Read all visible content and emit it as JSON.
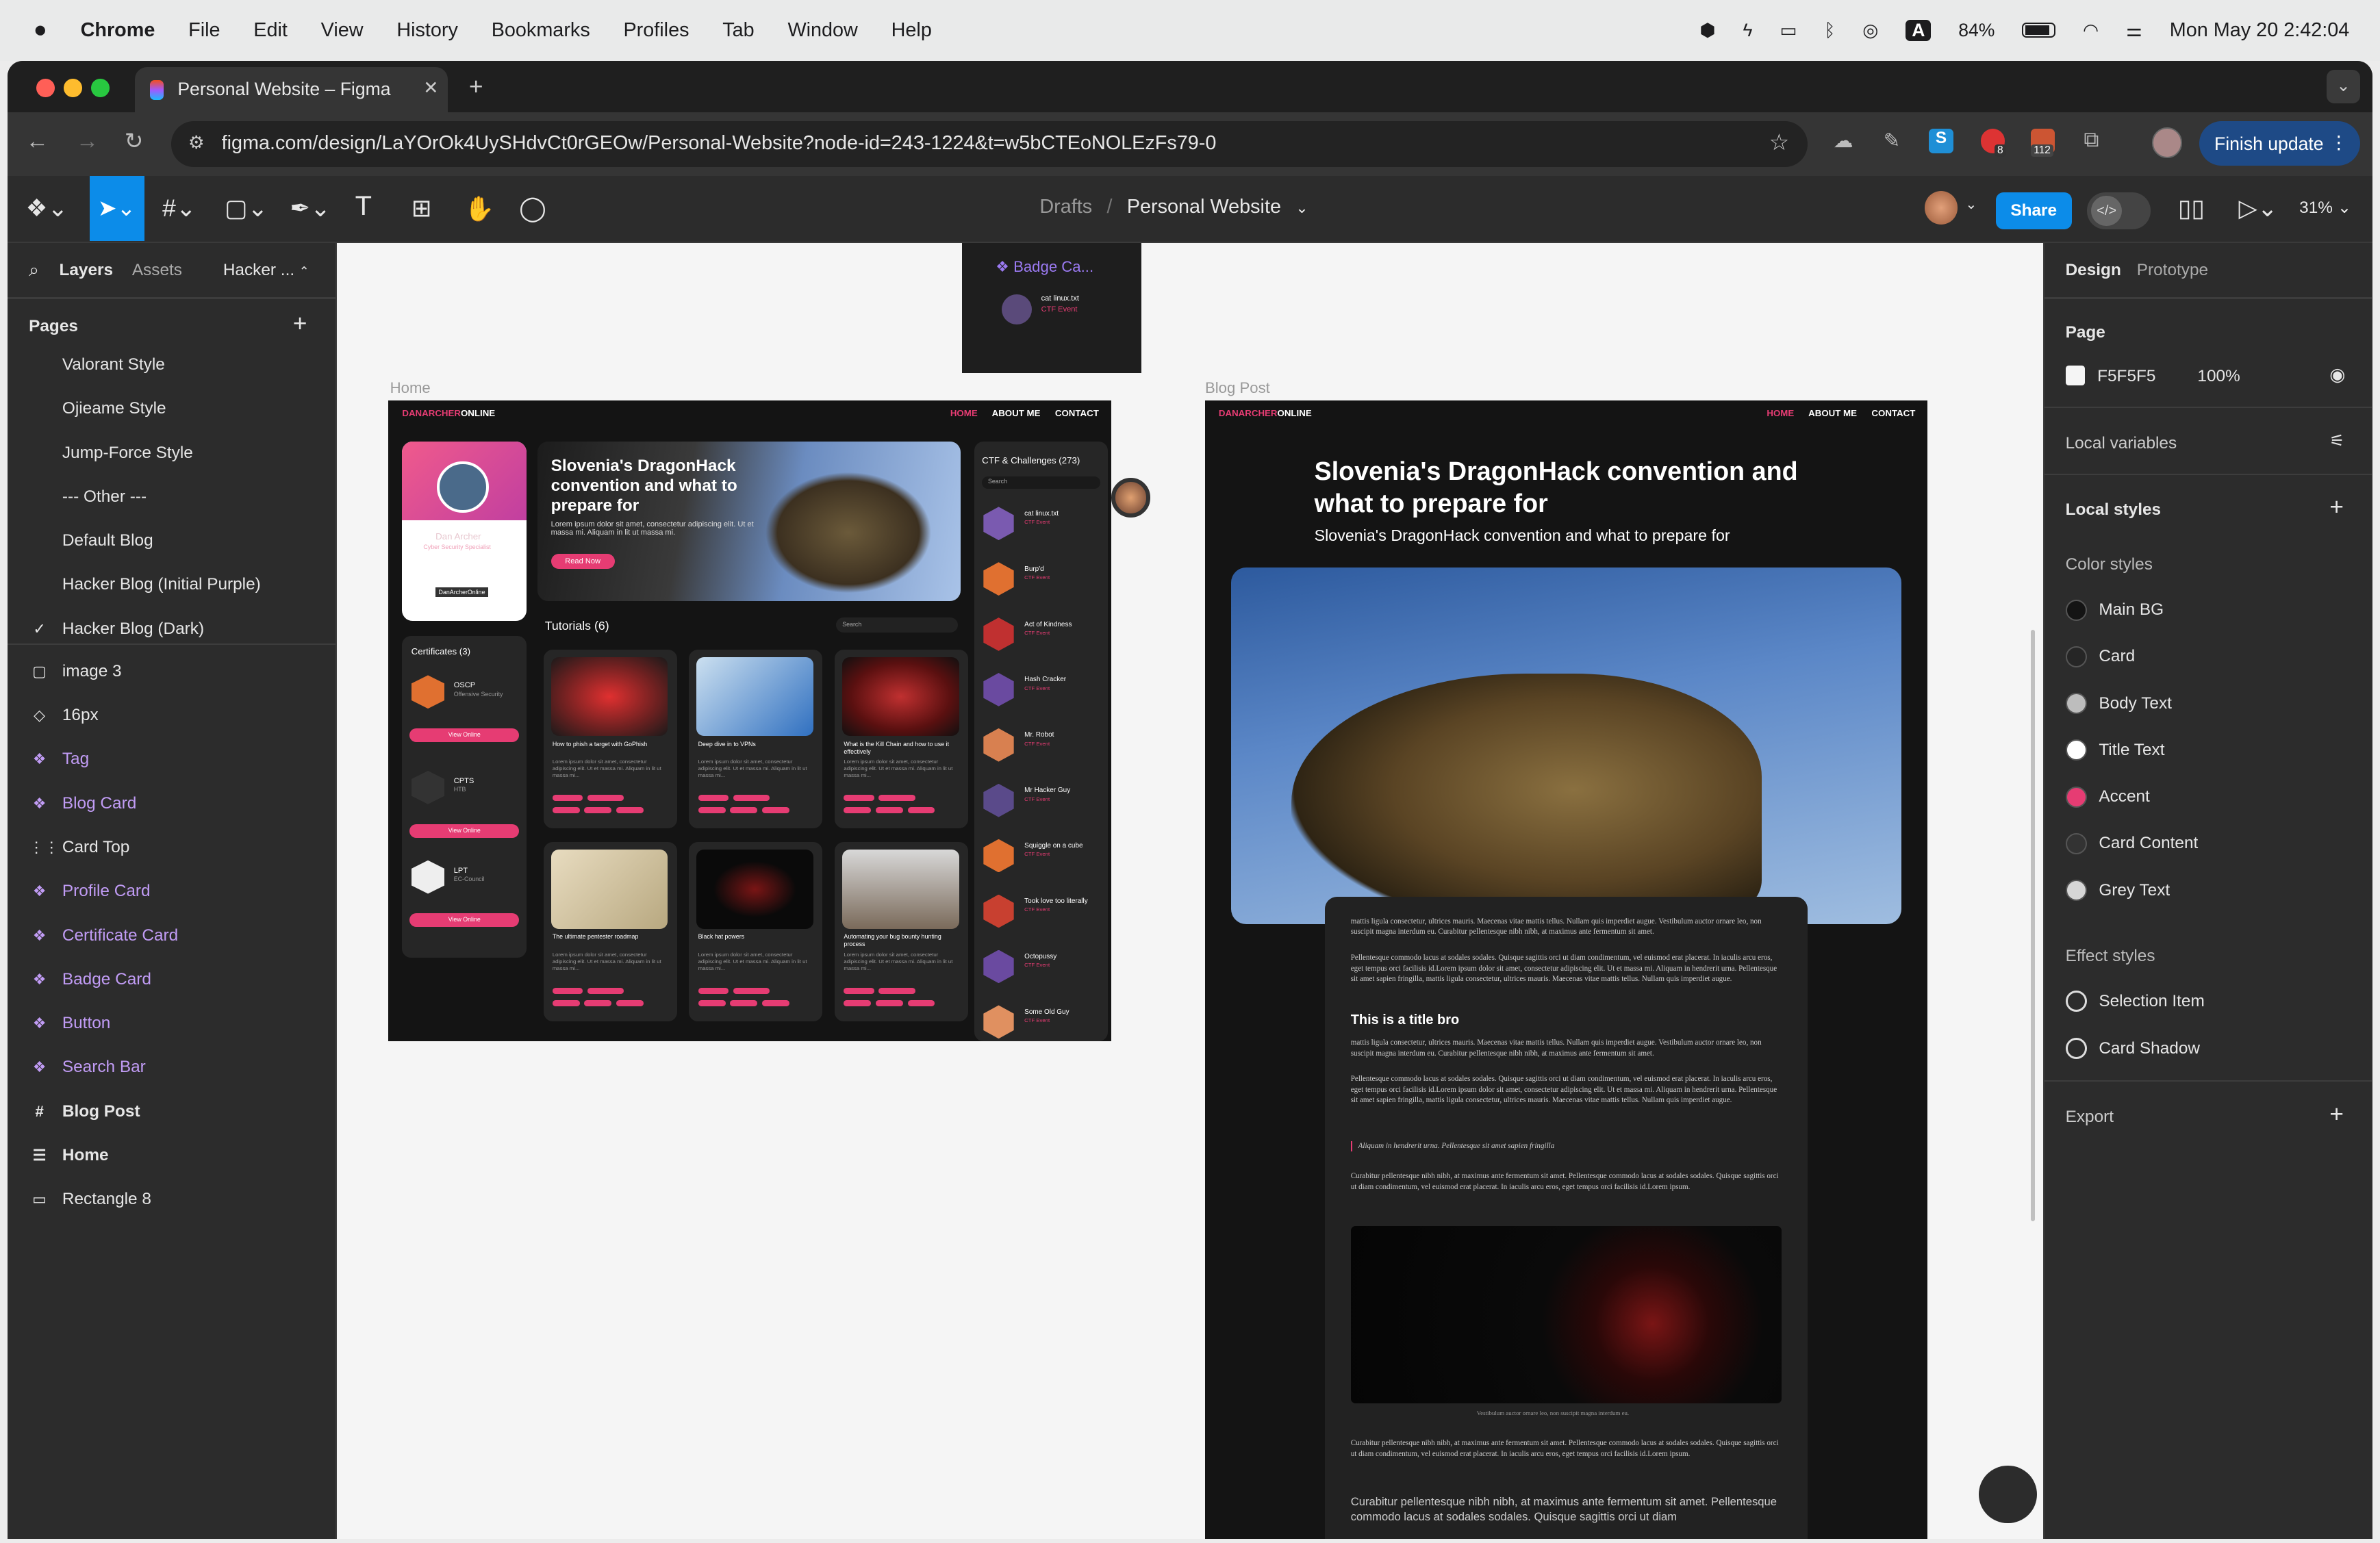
{
  "menubar": {
    "items": [
      "Chrome",
      "File",
      "Edit",
      "View",
      "History",
      "Bookmarks",
      "Profiles",
      "Tab",
      "Window",
      "Help"
    ],
    "battery": "84%",
    "clock": "Mon May 20  2:42:04",
    "input_source": "A"
  },
  "browser": {
    "tab_title": "Personal Website – Figma",
    "url": "figma.com/design/LaYOrOk4UySHdvCt0rGEOw/Personal-Website?node-id=243-1224&t=w5bCTEoNOLEzFs79-0",
    "finish_update": "Finish update",
    "ext_badge_1": "8",
    "ext_badge_2": "112"
  },
  "figma": {
    "breadcrumb_root": "Drafts",
    "breadcrumb_sep": "/",
    "file_name": "Personal Website",
    "share": "Share",
    "zoom": "31%"
  },
  "left": {
    "tab_layers": "Layers",
    "tab_assets": "Assets",
    "page_select": "Hacker ...",
    "pages_heading": "Pages",
    "pages": [
      {
        "label": "Valorant Style"
      },
      {
        "label": "Ojieame Style"
      },
      {
        "label": "Jump-Force Style"
      },
      {
        "label": "--- Other ---"
      },
      {
        "label": "Default Blog"
      },
      {
        "label": "Hacker Blog (Initial Purple)"
      },
      {
        "label": "Hacker Blog (Dark)",
        "check": "✓"
      }
    ],
    "layers": [
      {
        "label": "image 3",
        "icon": "▢"
      },
      {
        "label": "16px",
        "icon": "◇"
      },
      {
        "label": "Tag",
        "icon": "❖"
      },
      {
        "label": "Blog Card",
        "icon": "❖"
      },
      {
        "label": "Card Top",
        "icon": "⋮⋮"
      },
      {
        "label": "Profile Card",
        "icon": "❖"
      },
      {
        "label": "Certificate Card",
        "icon": "❖"
      },
      {
        "label": "Badge Card",
        "icon": "❖"
      },
      {
        "label": "Button",
        "icon": "❖"
      },
      {
        "label": "Search Bar",
        "icon": "❖"
      },
      {
        "label": "Blog Post",
        "icon": "#"
      },
      {
        "label": "Home",
        "icon": "☰"
      },
      {
        "label": "Rectangle 8",
        "icon": "▭"
      }
    ]
  },
  "right": {
    "tab_design": "Design",
    "tab_prototype": "Prototype",
    "page_heading": "Page",
    "page_color": "F5F5F5",
    "page_opacity": "100%",
    "local_variables": "Local variables",
    "local_styles": "Local styles",
    "color_styles": "Color styles",
    "colors": [
      {
        "label": "Main BG",
        "hex": "#141414"
      },
      {
        "label": "Card",
        "hex": "#262626"
      },
      {
        "label": "Body Text",
        "hex": "#bdbdbd"
      },
      {
        "label": "Title Text",
        "hex": "#ffffff"
      },
      {
        "label": "Accent",
        "hex": "#e63c73"
      },
      {
        "label": "Card Content",
        "hex": "#333333"
      },
      {
        "label": "Grey Text",
        "hex": "#d6d6d6"
      }
    ],
    "effect_styles": "Effect styles",
    "effects": [
      {
        "label": "Selection Item"
      },
      {
        "label": "Card Shadow"
      }
    ],
    "export": "Export"
  },
  "canvas": {
    "badge_frame": {
      "title": "❖ Badge Ca...",
      "item_title": "cat linux.txt",
      "item_sub": "CTF Event"
    },
    "home": {
      "frame_label": "Home",
      "logo_a": "DANARCHER",
      "logo_b": "ONLINE",
      "nav": [
        "HOME",
        "ABOUT ME",
        "CONTACT"
      ],
      "profile": {
        "name": "Dan Archer",
        "role": "Cyber Security Specialist",
        "handle": "DanArcherOnline"
      },
      "hero": {
        "title": "Slovenia's DragonHack convention and what to prepare for",
        "text": "Lorem ipsum dolor sit amet, consectetur adipiscing elit. Ut et massa mi. Aliquam in lit ut massa mi.",
        "button": "Read Now"
      },
      "certs": {
        "heading": "Certificates (3)",
        "items": [
          {
            "name": "OSCP",
            "org": "Offensive Security"
          },
          {
            "name": "CPTS",
            "org": "HTB"
          },
          {
            "name": "LPT",
            "org": "EC-Council"
          }
        ],
        "button": "View Online"
      },
      "tutorials": {
        "heading": "Tutorials (6)",
        "search": "Search",
        "cards": [
          {
            "title": "How to phish a target with GoPhish"
          },
          {
            "title": "Deep dive in to VPNs"
          },
          {
            "title": "What is the Kill Chain and how to use it effectively"
          },
          {
            "title": "The ultimate pentester roadmap"
          },
          {
            "title": "Black hat powers"
          },
          {
            "title": "Automating your bug bounty hunting process"
          }
        ],
        "body": "Lorem ipsum dolor sit amet, consectetur adipiscing elit. Ut et massa mi. Aliquam in lit ut massa mi..."
      },
      "ctf": {
        "heading": "CTF & Challenges (273)",
        "search": "Search",
        "event": "CTF Event",
        "items": [
          "cat linux.txt",
          "Burp'd",
          "Act of Kindness",
          "Hash Cracker",
          "Mr. Robot",
          "Mr Hacker Guy",
          "Squiggle on a cube",
          "Took love too literally",
          "Octopussy",
          "Some Old Guy"
        ]
      }
    },
    "blog": {
      "frame_label": "Blog Post",
      "logo_a": "DANARCHER",
      "logo_b": "ONLINE",
      "nav": [
        "HOME",
        "ABOUT ME",
        "CONTACT"
      ],
      "title": "Slovenia's DragonHack convention and what to prepare for",
      "subtitle": "Slovenia's DragonHack convention and what to prepare for",
      "p1": "mattis ligula consectetur, ultrices mauris. Maecenas vitae mattis tellus. Nullam quis imperdiet augue. Vestibulum auctor ornare leo, non suscipit magna interdum eu. Curabitur pellentesque nibh nibh, at maximus ante fermentum sit amet.",
      "p2": "Pellentesque commodo lacus at sodales sodales. Quisque sagittis orci ut diam condimentum, vel euismod erat placerat. In iaculis arcu eros, eget tempus orci facilisis id.Lorem ipsum dolor sit amet, consectetur adipiscing elit. Ut et massa mi. Aliquam in hendrerit urna. Pellentesque sit amet sapien fringilla, mattis ligula consectetur, ultrices mauris. Maecenas vitae mattis tellus. Nullam quis imperdiet augue.",
      "h2": "This is a title bro",
      "quote": "Aliquam in hendrerit urna. Pellentesque sit amet sapien fringilla",
      "p3": "Curabitur pellentesque nibh nibh, at maximus ante fermentum sit amet. Pellentesque commodo lacus at sodales sodales. Quisque sagittis orci ut diam condimentum, vel euismod erat placerat. In iaculis arcu eros, eget tempus orci facilisis id.Lorem ipsum.",
      "caption": "Vestibulum auctor ornare leo, non suscipit magna interdum eu.",
      "p4": "Curabitur pellentesque nibh nibh, at maximus ante fermentum sit amet. Pellentesque commodo lacus at sodales sodales. Quisque sagittis orci ut diam condimentum, vel euismod erat placerat. In iaculis arcu eros, eget tempus orci facilisis id.Lorem ipsum.",
      "p5": "Curabitur pellentesque nibh nibh, at maximus ante fermentum sit amet. Pellentesque commodo lacus at sodales sodales. Quisque sagittis orci ut diam"
    }
  }
}
